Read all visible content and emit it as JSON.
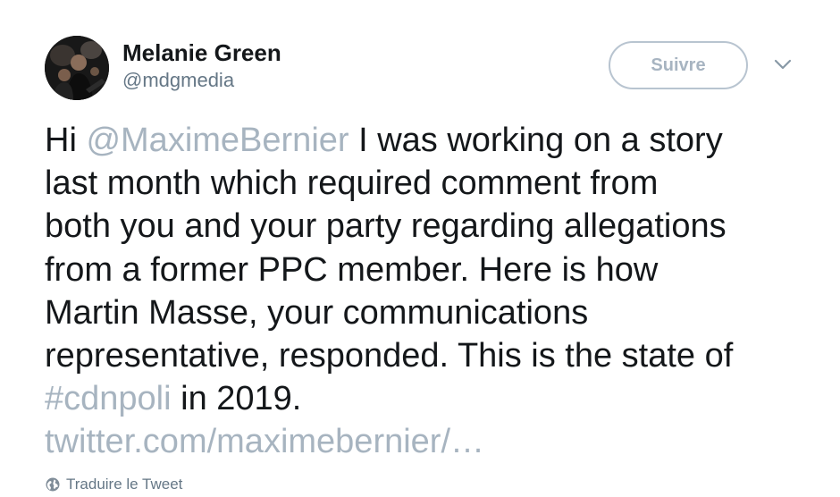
{
  "author": {
    "display_name": "Melanie Green",
    "handle": "@mdgmedia",
    "avatar_icon": "avatar-photo"
  },
  "follow_button": {
    "label": "Suivre"
  },
  "menu_icon": "chevron-down-icon",
  "tweet": {
    "lines": [
      {
        "prefix": "Hi ",
        "mention": "@MaximeBernier",
        "suffix": " I was working on a story"
      },
      {
        "text": "last month which required comment from"
      },
      {
        "text": "both you and your party regarding allegations"
      },
      {
        "text": "from a former PPC member. Here is how"
      },
      {
        "text": "Martin Masse, your communications"
      },
      {
        "text": "representative, responded. This is the state of"
      },
      {
        "hashtag": "#cdnpoli",
        "suffix": " in 2019."
      },
      {
        "link": "twitter.com/maximebernier/…"
      }
    ]
  },
  "translate": {
    "label": "Traduire le Tweet",
    "icon": "globe-icon"
  },
  "colors": {
    "text": "#14171a",
    "secondary": "#657786",
    "link_muted": "#a7b4c0",
    "button_border": "#b8c4d0"
  }
}
